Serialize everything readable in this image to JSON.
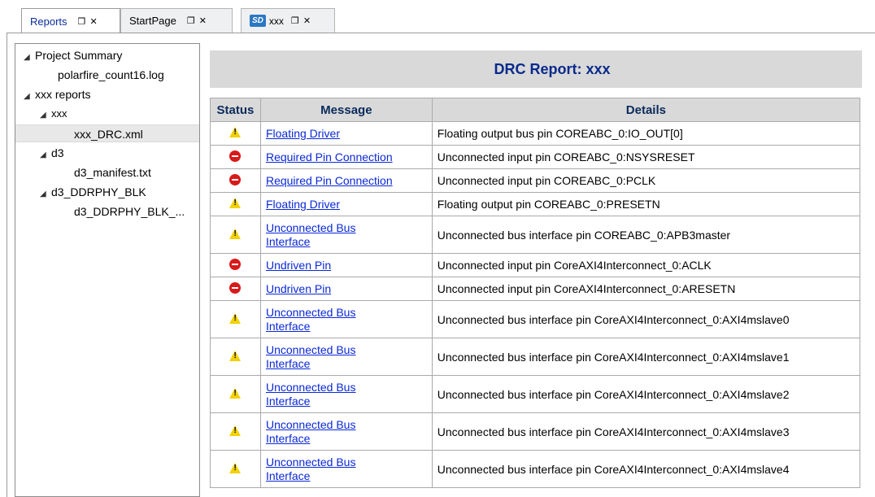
{
  "tabs": [
    {
      "label": "Reports",
      "controls": "❐ ✕",
      "active": true
    },
    {
      "label": "StartPage",
      "controls": "❐ ✕",
      "active": false
    },
    {
      "badge": "SD",
      "label": "xxx",
      "controls": "❐ ✕",
      "active": false
    }
  ],
  "tree": {
    "items": [
      {
        "label": "Project Summary",
        "expanded": true
      },
      {
        "label": "polarfire_count16.log"
      },
      {
        "label": "xxx reports",
        "expanded": true
      },
      {
        "label": "xxx",
        "expanded": true
      },
      {
        "label": "xxx_DRC.xml",
        "selected": true
      },
      {
        "label": "d3",
        "expanded": true
      },
      {
        "label": "d3_manifest.txt"
      },
      {
        "label": "d3_DDRPHY_BLK",
        "expanded": true
      },
      {
        "label": "d3_DDRPHY_BLK_..."
      }
    ],
    "expand_arrow": "◢"
  },
  "report": {
    "title": "DRC Report: xxx",
    "columns": [
      "Status",
      "Message",
      "Details"
    ],
    "rows": [
      {
        "status": "warning",
        "message": "Floating Driver",
        "details": "Floating output bus pin COREABC_0:IO_OUT[0]"
      },
      {
        "status": "error",
        "message": "Required Pin Connection",
        "details": "Unconnected input pin COREABC_0:NSYSRESET"
      },
      {
        "status": "error",
        "message": "Required Pin Connection",
        "details": "Unconnected input pin COREABC_0:PCLK"
      },
      {
        "status": "warning",
        "message": "Floating Driver",
        "details": "Floating output pin COREABC_0:PRESETN"
      },
      {
        "status": "warning",
        "message": "Unconnected Bus Interface",
        "details": "Unconnected bus interface pin COREABC_0:APB3master"
      },
      {
        "status": "error",
        "message": "Undriven Pin",
        "details": "Unconnected input pin CoreAXI4Interconnect_0:ACLK"
      },
      {
        "status": "error",
        "message": "Undriven Pin",
        "details": "Unconnected input pin CoreAXI4Interconnect_0:ARESETN"
      },
      {
        "status": "warning",
        "message": "Unconnected Bus Interface",
        "details": "Unconnected bus interface pin CoreAXI4Interconnect_0:AXI4mslave0"
      },
      {
        "status": "warning",
        "message": "Unconnected Bus Interface",
        "details": "Unconnected bus interface pin CoreAXI4Interconnect_0:AXI4mslave1"
      },
      {
        "status": "warning",
        "message": "Unconnected Bus Interface",
        "details": "Unconnected bus interface pin CoreAXI4Interconnect_0:AXI4mslave2"
      },
      {
        "status": "warning",
        "message": "Unconnected Bus Interface",
        "details": "Unconnected bus interface pin CoreAXI4Interconnect_0:AXI4mslave3"
      },
      {
        "status": "warning",
        "message": "Unconnected Bus Interface",
        "details": "Unconnected bus interface pin CoreAXI4Interconnect_0:AXI4mslave4"
      }
    ]
  },
  "colors": {
    "warning": "#f2d100",
    "error": "#d91a1a",
    "link": "#0a28d8",
    "title": "#0a2a8c"
  }
}
